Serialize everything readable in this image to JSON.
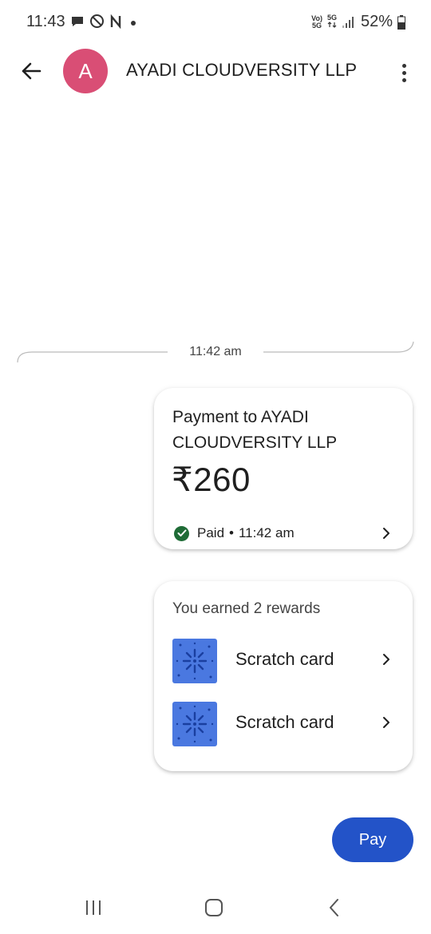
{
  "status_bar": {
    "time": "11:43",
    "network_badge_top": "Vo)",
    "network_badge_bottom": "5G",
    "network_type": "5G",
    "battery_percent": "52%"
  },
  "header": {
    "avatar_letter": "A",
    "title": "AYADI CLOUDVERSITY LLP"
  },
  "chat": {
    "timestamp": "11:42 am",
    "payment_card": {
      "title": "Payment to AYADI CLOUDVERSITY LLP",
      "amount": "₹260",
      "status": "Paid",
      "separator": "•",
      "time": "11:42 am"
    },
    "rewards_card": {
      "heading": "You earned 2 rewards",
      "items": [
        {
          "label": "Scratch card"
        },
        {
          "label": "Scratch card"
        }
      ]
    }
  },
  "pay_button_label": "Pay",
  "colors": {
    "avatar": "#d94e75",
    "pay_button": "#2353c8",
    "paid_check": "#1e6b36",
    "scratch_card": "#4a78e0"
  }
}
